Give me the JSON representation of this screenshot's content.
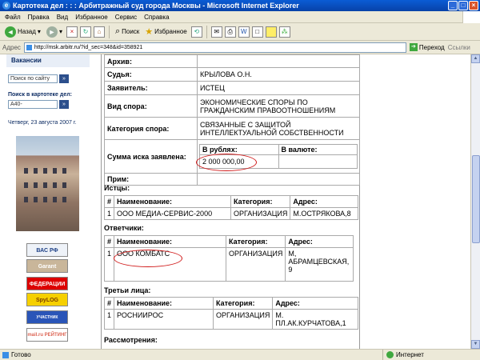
{
  "window": {
    "title": "Картотека дел : : : Арбитражный суд города Москвы - Microsoft Internet Explorer"
  },
  "menu": [
    "Файл",
    "Правка",
    "Вид",
    "Избранное",
    "Сервис",
    "Справка"
  ],
  "toolbar": {
    "back": "Назад",
    "search": "Поиск",
    "favorites": "Избранное"
  },
  "address": {
    "value": "http://msk.arbitr.ru/?id_sec=348&id=358921",
    "go": "Переход",
    "links": "Ссылки"
  },
  "sidebar": {
    "heading": "Вакансии",
    "search_site": "Поиск по сайту",
    "card_search_label": "Поиск в картотеке дел:",
    "card_search_value": "А40-",
    "date": "Четверг, 23 августа 2007 г.",
    "banners": [
      "ВАС РФ",
      "Garant INTERNET",
      "ФЕДЕРАЦИИ",
      "SpyLOG",
      "УЧАСТНИК Rambler's TOP100",
      "mail.ru РЕЙТИНГ"
    ]
  },
  "case": {
    "archive_label": "Архив:",
    "judge_label": "Судья:",
    "judge": "КРЫЛОВА О.Н.",
    "applicant_label": "Заявитель:",
    "applicant": "ИСТЕЦ",
    "dispute_label": "Вид спора:",
    "dispute": "ЭКОНОМИЧЕСКИЕ СПОРЫ ПО ГРАЖДАНСКИМ ПРАВООТНОШЕНИЯМ",
    "category_label": "Категория спора:",
    "category": "СВЯЗАННЫЕ С ЗАЩИТОЙ ИНТЕЛЛЕКТУАЛЬНОЙ СОБСТВЕННОСТИ",
    "sum_label": "Сумма иска заявлена:",
    "rub_label": "В рублях:",
    "cur_label": "В валюте:",
    "sum_rub": "2 000 000,00",
    "sum_cur": "",
    "note_label": "Прим:"
  },
  "plaintiffs": {
    "title": "Истцы:",
    "headers": [
      "#",
      "Наименование:",
      "Категория:",
      "Адрес:"
    ],
    "rows": [
      [
        "1",
        "ООО МЕДИА-СЕРВИС-2000",
        "ОРГАНИЗАЦИЯ",
        "М.ОСТРЯКОВА,8"
      ]
    ]
  },
  "defendants": {
    "title": "Ответчики:",
    "headers": [
      "#",
      "Наименование:",
      "Категория:",
      "Адрес:"
    ],
    "rows": [
      [
        "1",
        "ООО КОМБАТС",
        "ОРГАНИЗАЦИЯ",
        "М, АБРАМЦЕВСКАЯ, 9"
      ]
    ]
  },
  "third_parties": {
    "title": "Третьи лица:",
    "headers": [
      "#",
      "Наименование:",
      "Категория:",
      "Адрес:"
    ],
    "rows": [
      [
        "1",
        "РОСНИИРОС",
        "ОРГАНИЗАЦИЯ",
        "М. ПЛ.АК.КУРЧАТОВА,1"
      ]
    ]
  },
  "hearings_title": "Рассмотрения:",
  "status": {
    "text": "Готово",
    "zone": "Интернет"
  },
  "colors": {
    "accent": "#0a5cd5",
    "annotation": "#d01919"
  }
}
